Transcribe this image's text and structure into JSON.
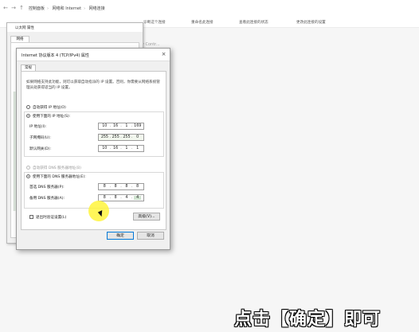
{
  "explorer": {
    "breadcrumb": [
      "控制面板",
      "网络和 Internet",
      "网络连接"
    ],
    "commands": [
      "诊断这个连接",
      "重命名此连接",
      "查看此连接的状态",
      "更改此连接的设置"
    ],
    "bg_text": "nily Contr..."
  },
  "eth": {
    "title": "以太网 属性",
    "tab": "网络"
  },
  "dialog": {
    "title": "Internet 协议版本 4 (TCP/IPv4) 属性",
    "tab_general": "常规",
    "description": "如果网络支持此功能，则可以获取自动指派的 IP 设置。否则，你需要从网络系统管理员处获得适当的 IP 设置。",
    "auto_ip_label": "自动获得 IP 地址(O)",
    "manual_ip_label": "使用下面的 IP 地址(S):",
    "ip_label": "IP 地址(I):",
    "ip_value": [
      "10",
      "16",
      "1",
      "169"
    ],
    "mask_label": "子网掩码(U):",
    "mask_value": [
      "255",
      "255",
      "255",
      "0"
    ],
    "gateway_label": "默认网关(D):",
    "gateway_value": [
      "10",
      "16",
      "1",
      "1"
    ],
    "auto_dns_label": "自动获得 DNS 服务器地址(B)",
    "manual_dns_label": "使用下面的 DNS 服务器地址(E):",
    "pref_dns_label": "首选 DNS 服务器(P):",
    "pref_dns_value": [
      "8",
      "8",
      "8",
      "8"
    ],
    "alt_dns_label": "备用 DNS 服务器(A):",
    "alt_dns_value": [
      "8",
      "8",
      "4",
      "4"
    ],
    "validate_label": "退出时验证设置(L)",
    "advanced_label": "高级(V)...",
    "ok_label": "确定",
    "cancel_label": "取消",
    "close_glyph": "×"
  },
  "caption": "点击【确定】即可",
  "icons": {
    "back": "back-arrow-icon",
    "forward": "forward-arrow-icon",
    "up": "up-arrow-icon",
    "cursor": "mouse-cursor-icon"
  },
  "colors": {
    "default_button_border": "#0078d7",
    "cursor_highlight": "#fff53c",
    "ip_highlight": "#cfe3cf"
  }
}
